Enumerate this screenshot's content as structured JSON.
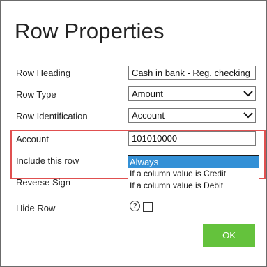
{
  "dialog": {
    "title": "Row Properties"
  },
  "fields": {
    "row_heading": {
      "label": "Row Heading",
      "value": "Cash in bank - Reg. checking"
    },
    "row_type": {
      "label": "Row Type",
      "value": "Amount"
    },
    "row_identification": {
      "label": "Row Identification",
      "value": "Account"
    },
    "account": {
      "label": "Account",
      "value": "101010000"
    },
    "include_this_row": {
      "label": "Include this row"
    },
    "reverse_sign": {
      "label": "Reverse Sign"
    },
    "hide_row": {
      "label": "Hide Row",
      "help_glyph": "?"
    }
  },
  "include_options": [
    "Always",
    "If a column value is Credit",
    "If a column value is Debit"
  ],
  "selected_option": "Always",
  "buttons": {
    "ok": "OK"
  },
  "colors": {
    "accent_green": "#64c23c",
    "selection_blue": "#3390d6",
    "highlight_red": "#e05050"
  },
  "icons": [
    "chevron-down-icon",
    "help-icon"
  ]
}
